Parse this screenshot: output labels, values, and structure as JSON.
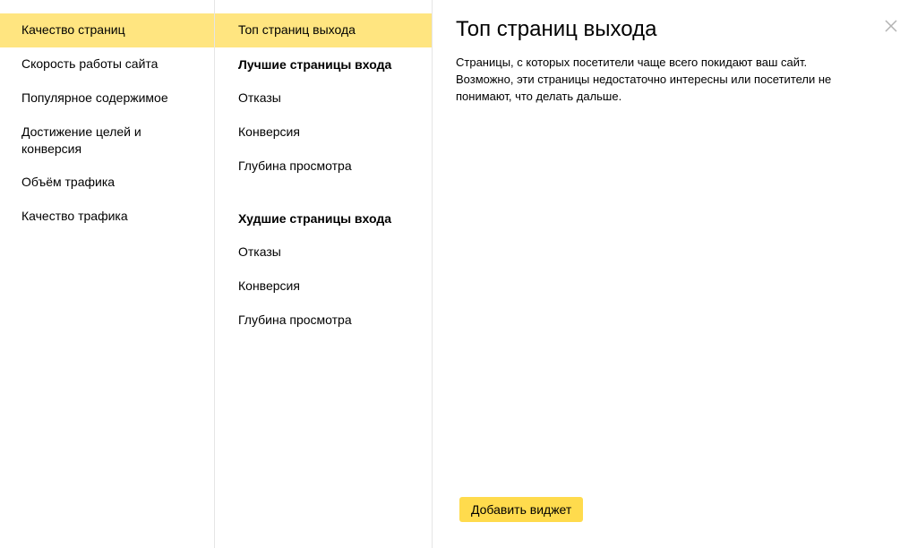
{
  "categories": {
    "items": [
      {
        "label": "Качество страниц",
        "active": true
      },
      {
        "label": "Скорость работы сайта"
      },
      {
        "label": "Популярное содержимое"
      },
      {
        "label": "Достижение целей и конверсия"
      },
      {
        "label": "Объём трафика"
      },
      {
        "label": "Качество трафика"
      }
    ]
  },
  "reports": {
    "top_item": {
      "label": "Топ страниц выхода",
      "active": true
    },
    "groups": [
      {
        "header": "Лучшие страницы входа",
        "items": [
          "Отказы",
          "Конверсия",
          "Глубина просмотра"
        ]
      },
      {
        "header": "Худшие страницы входа",
        "items": [
          "Отказы",
          "Конверсия",
          "Глубина просмотра"
        ]
      }
    ]
  },
  "panel": {
    "title": "Топ страниц выхода",
    "description": "Страницы, с которых посетители чаще всего покидают ваш сайт. Возможно, эти страницы недостаточно интересны или посетители не понимают, что делать дальше.",
    "add_button": "Добавить виджет",
    "close_icon": "close-icon"
  },
  "colors": {
    "active_bg": "#ffe580",
    "button_bg": "#ffdb4d",
    "divider": "#e5e5e5"
  }
}
